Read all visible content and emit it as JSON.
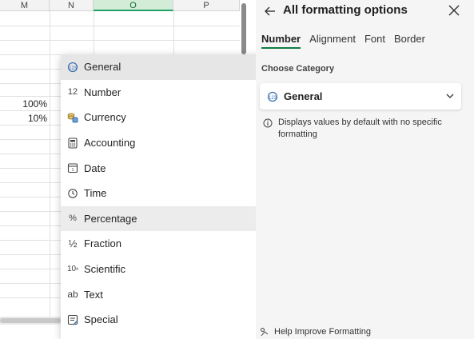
{
  "sheet": {
    "columns": [
      {
        "label": "M",
        "selected": false
      },
      {
        "label": "N",
        "selected": false
      },
      {
        "label": "O",
        "selected": true
      },
      {
        "label": "P",
        "selected": false
      }
    ],
    "cells": [
      {
        "column": "M",
        "value": "100%"
      },
      {
        "column": "M",
        "value": "10%"
      }
    ]
  },
  "dropdown": {
    "items": [
      {
        "label": "General",
        "icon": "general-icon",
        "state": "active"
      },
      {
        "label": "Number",
        "icon": "number-icon",
        "state": ""
      },
      {
        "label": "Currency",
        "icon": "currency-icon",
        "state": ""
      },
      {
        "label": "Accounting",
        "icon": "accounting-icon",
        "state": ""
      },
      {
        "label": "Date",
        "icon": "date-icon",
        "state": ""
      },
      {
        "label": "Time",
        "icon": "time-icon",
        "state": ""
      },
      {
        "label": "Percentage",
        "icon": "percentage-icon",
        "state": "hover"
      },
      {
        "label": "Fraction",
        "icon": "fraction-icon",
        "state": ""
      },
      {
        "label": "Scientific",
        "icon": "scientific-icon",
        "state": ""
      },
      {
        "label": "Text",
        "icon": "text-icon",
        "state": ""
      },
      {
        "label": "Special",
        "icon": "special-icon",
        "state": ""
      }
    ],
    "number_glyph": "12",
    "percent_glyph": "%",
    "fraction_glyph": "½",
    "scientific_glyph": "10",
    "text_glyph": "ab"
  },
  "pane": {
    "title": "All formatting options",
    "tabs": [
      {
        "label": "Number",
        "active": true
      },
      {
        "label": "Alignment",
        "active": false
      },
      {
        "label": "Font",
        "active": false
      },
      {
        "label": "Border",
        "active": false
      }
    ],
    "choose_label": "Choose Category",
    "selected_category": "General",
    "description": "Displays values by default with no specific formatting",
    "help_label": "Help Improve Formatting"
  },
  "colors": {
    "accent": "#107c41",
    "selected_column": "#d2ecd8",
    "active_item": "#e6e6e6",
    "pane_bg": "#f5f5f5"
  }
}
